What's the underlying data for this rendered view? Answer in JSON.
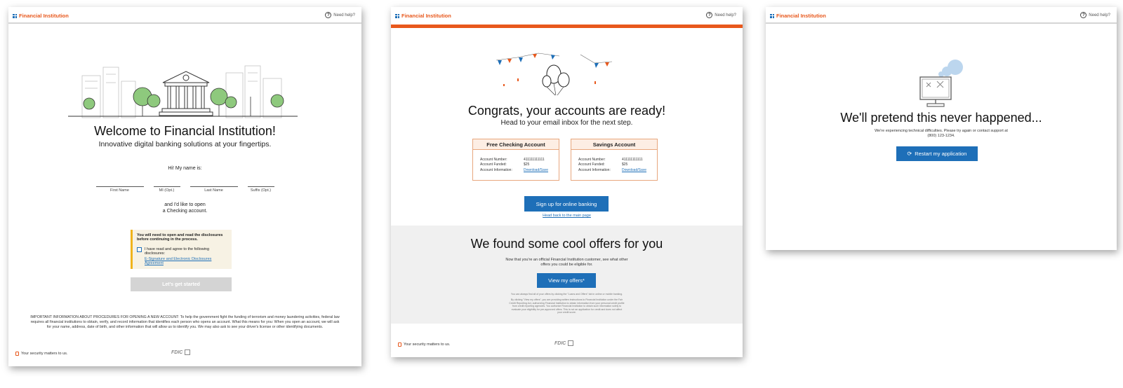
{
  "brand": "Financial Institution",
  "help": "Need help?",
  "security": "Your security matters to us.",
  "fdic": "FDIC",
  "welcome": {
    "title": "Welcome to Financial Institution!",
    "subtitle": "Innovative digital banking solutions at your fingertips.",
    "name_intro": "Hi! My name is:",
    "fields": [
      {
        "label": "First Name"
      },
      {
        "label": "MI (Opt.)"
      },
      {
        "label": "Last Name"
      },
      {
        "label": "Suffix (Opt.)"
      }
    ],
    "open_line1": "and I'd like to open",
    "open_line2": "a Checking account.",
    "disclosure_heading": "You will need to open and read the disclosures before continuing in the process.",
    "agree_label": "I have read and agree to the following disclosures:",
    "disclosure_link": "E-Signature and Electronic Disclosures Agreement",
    "start_button": "Let's get started",
    "important_info": "IMPORTANT INFORMATION ABOUT PROCEDURES FOR OPENING A NEW ACCOUNT: To help the government fight the funding of terrorism and money laundering activities, federal law requires all financial institutions to obtain, verify, and record information that identifies each person who opens an account. What this means for you: When you open an account, we will ask for your name, address, date of birth, and other information that will allow us to identify you. We may also ask to see your driver's license or other identifying documents."
  },
  "congrats": {
    "title": "Congrats, your accounts are ready!",
    "subtitle": "Head to your email inbox for the next step.",
    "accounts": [
      {
        "name": "Free Checking Account",
        "number_label": "Account Number:",
        "number": "411111111111",
        "funded_label": "Account Funded:",
        "funded": "$25",
        "info_label": "Account Information:",
        "info_link": "Download/Save"
      },
      {
        "name": "Savings Account",
        "number_label": "Account Number:",
        "number": "411111111111",
        "funded_label": "Account Funded:",
        "funded": "$25",
        "info_label": "Account Information:",
        "info_link": "Download/Save"
      }
    ],
    "signup_button": "Sign up for online banking",
    "back_link": "Head back to the main page",
    "offers_title": "We found some cool offers for you",
    "offers_text": "Now that you're an official Financial Institution customer, see what other offers you could be eligible for.",
    "offers_button": "View my offers*",
    "fine1": "You can always find all of your offers by clicking the \"Loans and Offers\" tab in online or mobile banking.",
    "fine2": "By clicking \"View my offers\", you are providing written instructions to Financial Institution under the Fair Credit Reporting Act, authorizing Financial Institution to obtain information from your personal credit profile from credit reporting agencies. You authorize Financial Institution to obtain such information solely to evaluate your eligibility for pre-approved offers. This is not an application for credit and does not affect your credit score."
  },
  "error": {
    "title": "We'll pretend this never happened...",
    "message": "We're experiencing technical difficulties. Please try again or contact support at",
    "phone": "(800) 123-1234.",
    "button": "Restart my application"
  }
}
